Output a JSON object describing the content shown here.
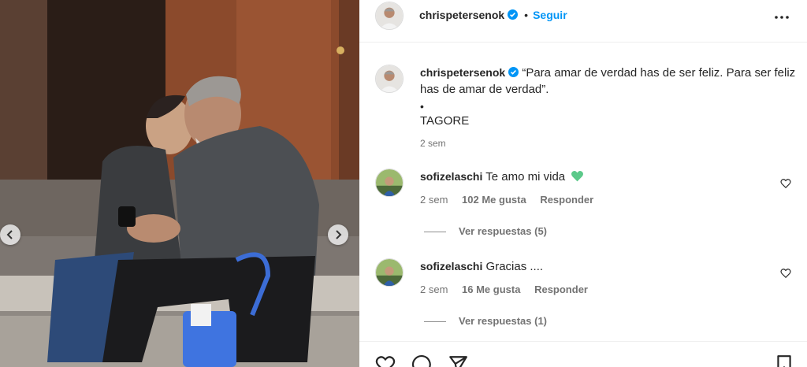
{
  "post": {
    "username": "chrispetersenok",
    "separator": "•",
    "follow_label": "Seguir"
  },
  "caption": {
    "username": "chrispetersenok",
    "text": "“Para amar de verdad has de ser feliz. Para ser feliz has de amar de verdad”.",
    "bullet": "•",
    "author": "TAGORE",
    "time": "2 sem"
  },
  "comments": [
    {
      "username": "sofizelaschi",
      "text": "Te amo mi vida",
      "emoji": "green-heart",
      "time": "2 sem",
      "likes": "102 Me gusta",
      "reply_label": "Responder",
      "replies_label": "Ver respuestas (5)"
    },
    {
      "username": "sofizelaschi",
      "text": "Gracias ....",
      "time": "2 sem",
      "likes": "16 Me gusta",
      "reply_label": "Responder",
      "replies_label": "Ver respuestas (1)"
    }
  ],
  "colors": {
    "follow": "#0095f6",
    "verified": "#0095f6",
    "emoji_heart": "#5cc98a",
    "muted_text": "#737373"
  },
  "icons": [
    "chevron-left-icon",
    "chevron-right-icon",
    "verified-badge-icon",
    "more-options-icon",
    "like-heart-icon",
    "comment-icon",
    "share-icon",
    "save-icon"
  ]
}
